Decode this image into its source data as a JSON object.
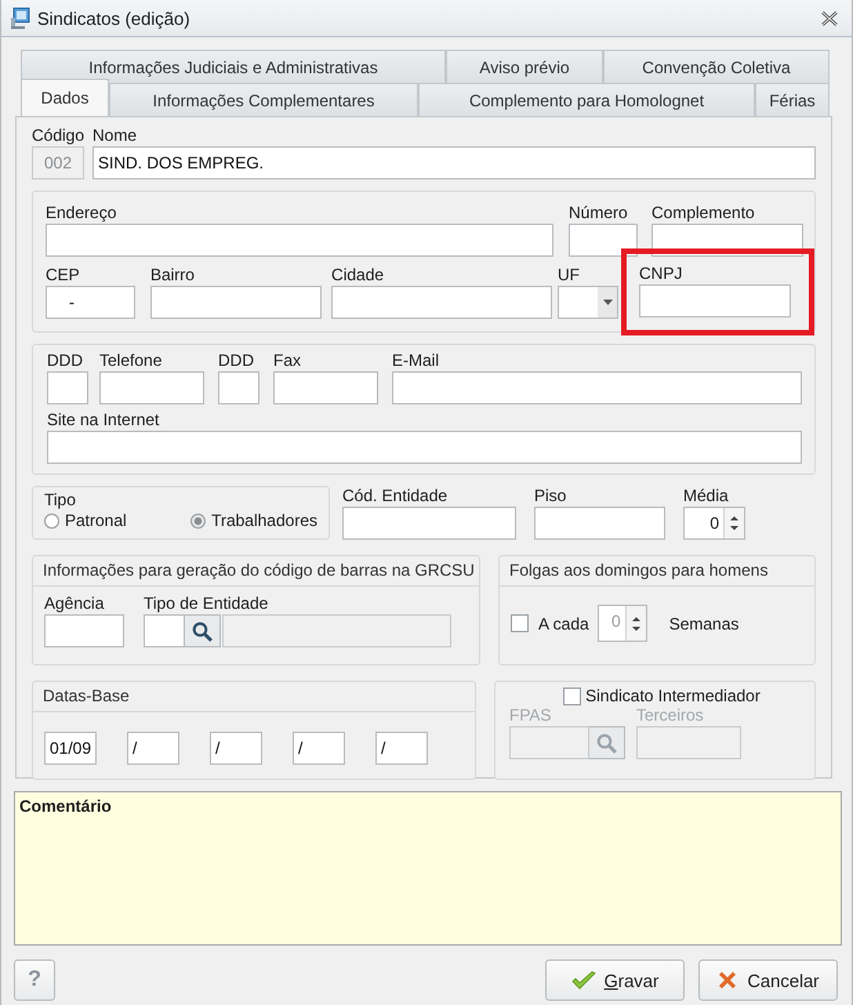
{
  "window": {
    "title": "Sindicatos (edição)"
  },
  "tabs_row1": [
    {
      "label": "Informações Judiciais e Administrativas",
      "selected": false
    },
    {
      "label": "Aviso prévio",
      "selected": false
    },
    {
      "label": "Convenção Coletiva",
      "selected": false
    }
  ],
  "tabs_row2": [
    {
      "label": "Dados",
      "selected": true
    },
    {
      "label": "Informações Complementares",
      "selected": false
    },
    {
      "label": "Complemento para Homolognet",
      "selected": false
    },
    {
      "label": "Férias",
      "selected": false
    }
  ],
  "codigo": {
    "label": "Código",
    "value": "002",
    "disabled": true
  },
  "nome": {
    "label": "Nome",
    "value": "SIND. DOS EMPREG."
  },
  "address": {
    "endereco": {
      "label": "Endereço"
    },
    "numero": {
      "label": "Número"
    },
    "complemento": {
      "label": "Complemento"
    },
    "cep": {
      "label": "CEP",
      "value": "-"
    },
    "bairro": {
      "label": "Bairro"
    },
    "cidade": {
      "label": "Cidade"
    },
    "uf": {
      "label": "UF"
    },
    "cnpj": {
      "label": "CNPJ",
      "highlighted": true
    }
  },
  "contact": {
    "ddd_telefone": {
      "label": "DDD"
    },
    "telefone": {
      "label": "Telefone"
    },
    "ddd_fax": {
      "label": "DDD"
    },
    "fax": {
      "label": "Fax"
    },
    "email": {
      "label": "E-Mail"
    },
    "site": {
      "label": "Site na Internet"
    }
  },
  "tipo": {
    "title": "Tipo",
    "options": [
      {
        "label": "Patronal",
        "selected": false
      },
      {
        "label": "Trabalhadores",
        "selected": true
      }
    ]
  },
  "cod_entidade": {
    "label": "Cód. Entidade"
  },
  "piso": {
    "label": "Piso"
  },
  "media": {
    "label": "Média",
    "value": "0"
  },
  "grcsu": {
    "title": "Informações para geração do código de barras na GRCSU",
    "agencia": {
      "label": "Agência"
    },
    "tipo_entidade": {
      "label": "Tipo de Entidade",
      "description_disabled": true
    }
  },
  "folgas": {
    "title": "Folgas aos domingos para homens",
    "checked": false,
    "label": "A cada",
    "value": "0",
    "value_disabled": true,
    "unit": "Semanas"
  },
  "datas_base": {
    "title": "Datas-Base",
    "values": [
      "01/09",
      "/",
      "/",
      "/",
      "/"
    ]
  },
  "intermediador": {
    "label": "Sindicato Intermediador",
    "checked": false,
    "fpas": {
      "label": "FPAS",
      "disabled": true
    },
    "terceiros": {
      "label": "Terceiros",
      "disabled": true
    }
  },
  "comentario": {
    "label": "Comentário"
  },
  "buttons": [
    {
      "kind": "help",
      "label": "?"
    },
    {
      "kind": "save",
      "label": "Gravar",
      "underline_first": true
    },
    {
      "kind": "cancel",
      "label": "Cancelar",
      "underline_first": false
    }
  ]
}
